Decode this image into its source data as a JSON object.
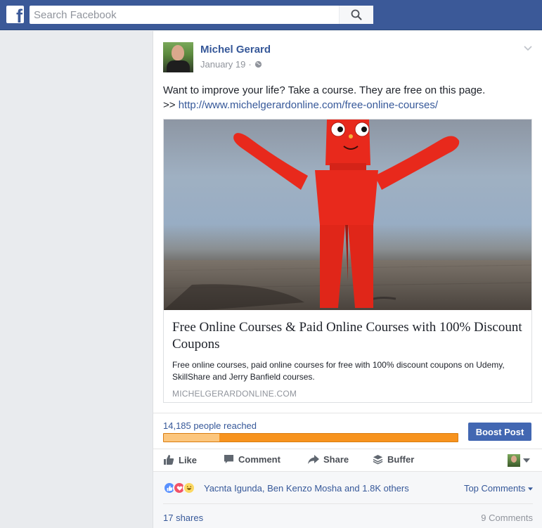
{
  "topbar": {
    "logo_letter": "f",
    "search_placeholder": "Search Facebook"
  },
  "post": {
    "author": "Michel Gerard",
    "date": "January 19",
    "separator": "·",
    "text_line1": "Want to improve your life? Take a course. They are free on this page.",
    "text_prefix": ">> ",
    "link": "http://www.michelgerardonline.com/free-online-courses/"
  },
  "link_card": {
    "title": "Free Online Courses & Paid Online Courses with 100% Discount Coupons",
    "description": "Free online courses, paid online courses for free with 100% discount coupons on Udemy, SkillShare and Jerry Banfield courses.",
    "domain": "MICHELGERARDONLINE.COM"
  },
  "insights": {
    "reach_label": "14,185 people reached",
    "organic_fraction": 0.19,
    "boost_label": "Boost Post"
  },
  "actions": {
    "like": "Like",
    "comment": "Comment",
    "share": "Share",
    "buffer": "Buffer"
  },
  "engagement": {
    "reactors": "Yacnta Igunda, Ben Kenzo Mosha and 1.8K others",
    "top_comments": "Top Comments",
    "shares": "17 shares",
    "comments": "9 Comments"
  },
  "colors": {
    "brand": "#3b5998",
    "link": "#365899",
    "boost": "#4267b2",
    "reach_paid": "#f7931e",
    "reach_organic": "#fcc67d"
  }
}
